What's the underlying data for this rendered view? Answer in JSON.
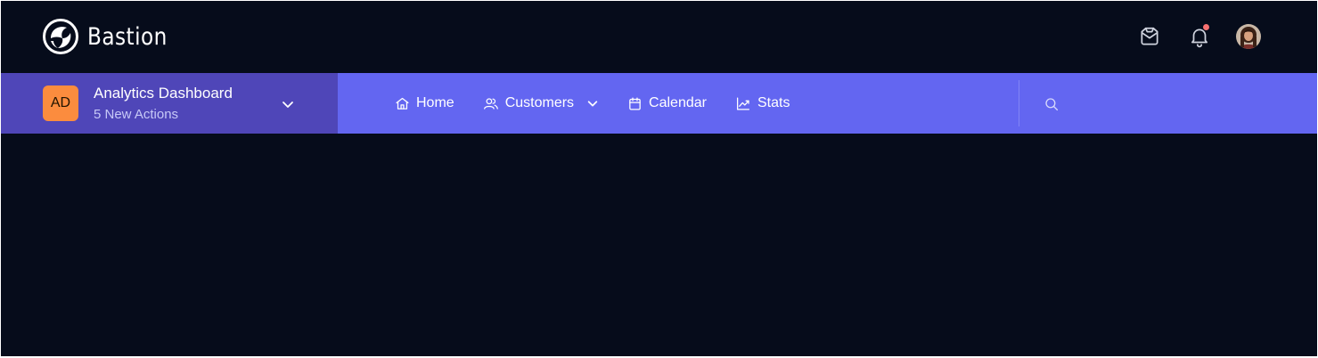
{
  "app": {
    "name": "Bastion"
  },
  "topbar": {
    "icons": [
      "inbox-icon",
      "bell-icon"
    ],
    "has_notification": true
  },
  "workspace": {
    "initials": "AD",
    "title": "Analytics Dashboard",
    "subtitle": "5 New Actions",
    "badge_color": "#fb8c3e"
  },
  "nav": {
    "items": [
      {
        "label": "Home",
        "icon": "home-icon"
      },
      {
        "label": "Customers",
        "icon": "users-icon",
        "has_dropdown": true
      },
      {
        "label": "Calendar",
        "icon": "calendar-icon"
      },
      {
        "label": "Stats",
        "icon": "chart-line-icon"
      }
    ]
  },
  "colors": {
    "background": "#060c1b",
    "nav_bar": "#6366f1",
    "workspace_panel": "#4f46b8",
    "notification_dot": "#f87171"
  }
}
